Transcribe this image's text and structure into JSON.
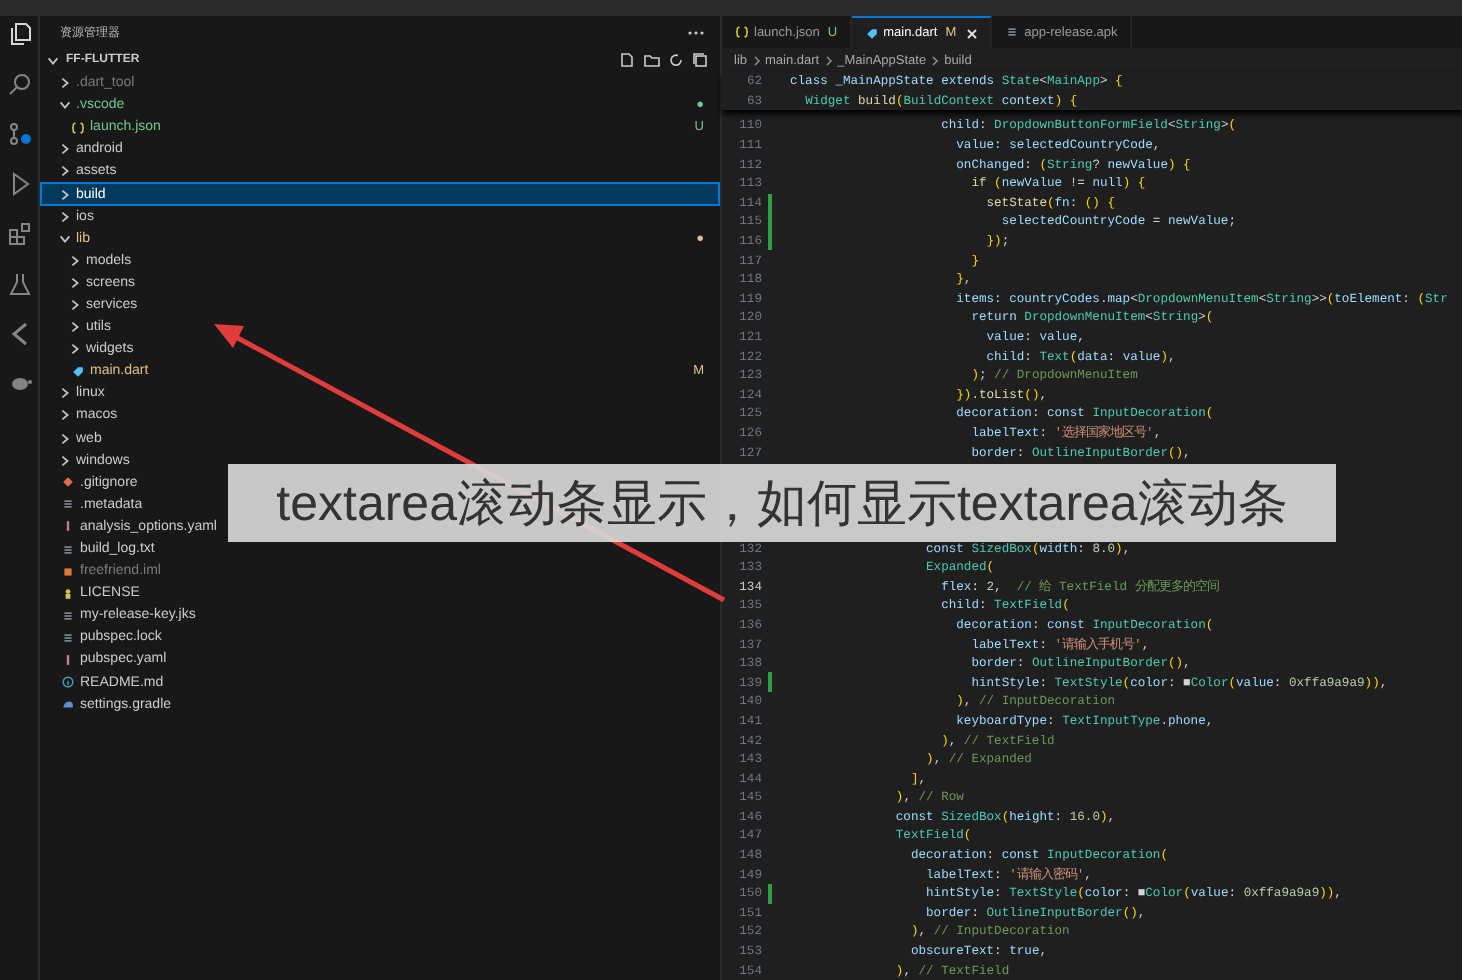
{
  "sidebar": {
    "title": "资源管理器",
    "root": "FF-FLUTTER",
    "root_expanded": true,
    "tree": [
      {
        "label": ".dart_tool",
        "kind": "folder",
        "expanded": false,
        "selected": false,
        "color": "#7a7a7a"
      },
      {
        "label": ".vscode",
        "kind": "folder",
        "expanded": true,
        "selected": false,
        "color": "#73c991",
        "badge": "●",
        "children": [
          {
            "label": "launch.json",
            "kind": "json",
            "selected": false,
            "color": "#73c991",
            "badge": "U"
          }
        ]
      },
      {
        "label": "android",
        "kind": "folder",
        "expanded": false,
        "selected": false,
        "color": "#cccccc"
      },
      {
        "label": "assets",
        "kind": "folder",
        "expanded": false,
        "selected": false,
        "color": "#cccccc"
      },
      {
        "label": "build",
        "kind": "folder",
        "expanded": false,
        "selected": true,
        "color": "#ffffff"
      },
      {
        "label": "ios",
        "kind": "folder",
        "expanded": false,
        "selected": false,
        "color": "#cccccc"
      },
      {
        "label": "lib",
        "kind": "folder",
        "expanded": true,
        "selected": false,
        "color": "#e2c08d",
        "badge": "●",
        "children": [
          {
            "label": "models",
            "kind": "folder",
            "expanded": false,
            "selected": false,
            "color": "#cccccc"
          },
          {
            "label": "screens",
            "kind": "folder",
            "expanded": false,
            "selected": false,
            "color": "#cccccc"
          },
          {
            "label": "services",
            "kind": "folder",
            "expanded": false,
            "selected": false,
            "color": "#cccccc"
          },
          {
            "label": "utils",
            "kind": "folder",
            "expanded": false,
            "selected": false,
            "color": "#cccccc"
          },
          {
            "label": "widgets",
            "kind": "folder",
            "expanded": false,
            "selected": false,
            "color": "#cccccc"
          },
          {
            "label": "main.dart",
            "kind": "dart",
            "selected": false,
            "color": "#e2c08d",
            "badge": "M"
          }
        ]
      },
      {
        "label": "linux",
        "kind": "folder",
        "expanded": false,
        "selected": false,
        "color": "#cccccc"
      },
      {
        "label": "macos",
        "kind": "folder",
        "expanded": false,
        "selected": false,
        "color": "#cccccc"
      },
      {
        "label": "web",
        "kind": "folder",
        "expanded": false,
        "selected": false,
        "color": "#cccccc"
      },
      {
        "label": "windows",
        "kind": "folder",
        "expanded": false,
        "selected": false,
        "color": "#cccccc"
      },
      {
        "label": ".gitignore",
        "kind": "git",
        "selected": false,
        "color": "#cccccc"
      },
      {
        "label": ".metadata",
        "kind": "text",
        "selected": false,
        "color": "#cccccc"
      },
      {
        "label": "analysis_options.yaml",
        "kind": "yaml",
        "selected": false,
        "color": "#cccccc"
      },
      {
        "label": "build_log.txt",
        "kind": "text",
        "selected": false,
        "color": "#cccccc"
      },
      {
        "label": "freefriend.iml",
        "kind": "xml",
        "selected": false,
        "color": "#7a7a7a"
      },
      {
        "label": "LICENSE",
        "kind": "license",
        "selected": false,
        "color": "#cccccc"
      },
      {
        "label": "my-release-key.jks",
        "kind": "text",
        "selected": false,
        "color": "#cccccc"
      },
      {
        "label": "pubspec.lock",
        "kind": "text",
        "selected": false,
        "color": "#cccccc"
      },
      {
        "label": "pubspec.yaml",
        "kind": "yaml",
        "selected": false,
        "color": "#cccccc"
      },
      {
        "label": "README.md",
        "kind": "info",
        "selected": false,
        "color": "#cccccc"
      },
      {
        "label": "settings.gradle",
        "kind": "gradle",
        "selected": false,
        "color": "#cccccc"
      }
    ]
  },
  "tabs": [
    {
      "label": "launch.json",
      "kind": "json",
      "badge": "U",
      "selected": false
    },
    {
      "label": "main.dart",
      "kind": "dart",
      "badge": "M",
      "selected": true
    },
    {
      "label": "app-release.apk",
      "kind": "text",
      "selected": false
    }
  ],
  "breadcrumb": [
    "lib",
    "main.dart",
    "_MainAppState",
    "build"
  ],
  "sticky_lines": [
    {
      "n": "62",
      "code": "class _MainAppState extends State<MainApp> {"
    },
    {
      "n": "63",
      "code": "  Widget build(BuildContext context) {"
    }
  ],
  "lines": [
    {
      "n": "110",
      "code": "                    child: DropdownButtonFormField<String>(",
      "added": false,
      "current": false
    },
    {
      "n": "111",
      "code": "                      value: selectedCountryCode,",
      "added": false,
      "current": false
    },
    {
      "n": "112",
      "code": "                      onChanged: (String? newValue) {",
      "added": false,
      "current": false
    },
    {
      "n": "113",
      "code": "                        if (newValue != null) {",
      "added": false,
      "current": false
    },
    {
      "n": "114",
      "code": "                          setState(fn: () {",
      "added": true,
      "current": false
    },
    {
      "n": "115",
      "code": "                            selectedCountryCode = newValue;",
      "added": true,
      "current": false
    },
    {
      "n": "116",
      "code": "                          });",
      "added": true,
      "current": false
    },
    {
      "n": "117",
      "code": "                        }",
      "added": false,
      "current": false
    },
    {
      "n": "118",
      "code": "                      },",
      "added": false,
      "current": false
    },
    {
      "n": "119",
      "code": "                      items: countryCodes.map<DropdownMenuItem<String>>(toElement: (Str",
      "added": false,
      "current": false
    },
    {
      "n": "120",
      "code": "                        return DropdownMenuItem<String>(",
      "added": false,
      "current": false
    },
    {
      "n": "121",
      "code": "                          value: value,",
      "added": false,
      "current": false
    },
    {
      "n": "122",
      "code": "                          child: Text(data: value),",
      "added": false,
      "current": false
    },
    {
      "n": "123",
      "code": "                        ); // DropdownMenuItem",
      "added": false,
      "current": false
    },
    {
      "n": "124",
      "code": "                      }).toList(),",
      "added": false,
      "current": false
    },
    {
      "n": "125",
      "code": "                      decoration: const InputDecoration(",
      "added": false,
      "current": false
    },
    {
      "n": "126",
      "code": "                        labelText: '选择国家地区号',",
      "added": false,
      "current": false
    },
    {
      "n": "127",
      "code": "                        border: OutlineInputBorder(),",
      "added": false,
      "current": false
    },
    {
      "n": "132",
      "code": "                  const SizedBox(width: 8.0),",
      "added": false,
      "current": false
    },
    {
      "n": "133",
      "code": "                  Expanded(",
      "added": false,
      "current": false
    },
    {
      "n": "134",
      "code": "                    flex: 2,  // 给 TextField 分配更多的空间",
      "added": false,
      "current": true
    },
    {
      "n": "135",
      "code": "                    child: TextField(",
      "added": false,
      "current": false
    },
    {
      "n": "136",
      "code": "                      decoration: const InputDecoration(",
      "added": false,
      "current": false
    },
    {
      "n": "137",
      "code": "                        labelText: '请输入手机号',",
      "added": false,
      "current": false
    },
    {
      "n": "138",
      "code": "                        border: OutlineInputBorder(),",
      "added": false,
      "current": false
    },
    {
      "n": "139",
      "code": "                        hintStyle: TextStyle(color: ■Color(value: 0xffa9a9a9)),",
      "added": true,
      "current": false
    },
    {
      "n": "140",
      "code": "                      ), // InputDecoration",
      "added": false,
      "current": false
    },
    {
      "n": "141",
      "code": "                      keyboardType: TextInputType.phone,",
      "added": false,
      "current": false
    },
    {
      "n": "142",
      "code": "                    ), // TextField",
      "added": false,
      "current": false
    },
    {
      "n": "143",
      "code": "                  ), // Expanded",
      "added": false,
      "current": false
    },
    {
      "n": "144",
      "code": "                ],",
      "added": false,
      "current": false
    },
    {
      "n": "145",
      "code": "              ), // Row",
      "added": false,
      "current": false
    },
    {
      "n": "146",
      "code": "              const SizedBox(height: 16.0),",
      "added": false,
      "current": false
    },
    {
      "n": "147",
      "code": "              TextField(",
      "added": false,
      "current": false
    },
    {
      "n": "148",
      "code": "                decoration: const InputDecoration(",
      "added": false,
      "current": false
    },
    {
      "n": "149",
      "code": "                  labelText: '请输入密码',",
      "added": false,
      "current": false
    },
    {
      "n": "150",
      "code": "                  hintStyle: TextStyle(color: ■Color(value: 0xffa9a9a9)),",
      "added": true,
      "current": false
    },
    {
      "n": "151",
      "code": "                  border: OutlineInputBorder(),",
      "added": false,
      "current": false
    },
    {
      "n": "152",
      "code": "                ), // InputDecoration",
      "added": false,
      "current": false
    },
    {
      "n": "153",
      "code": "                obscureText: true,",
      "added": false,
      "current": false
    },
    {
      "n": "154",
      "code": "              ), // TextField",
      "added": false,
      "current": false
    }
  ],
  "caption": {
    "text": "textarea滚动条显示，如何显示textarea滚动条"
  }
}
